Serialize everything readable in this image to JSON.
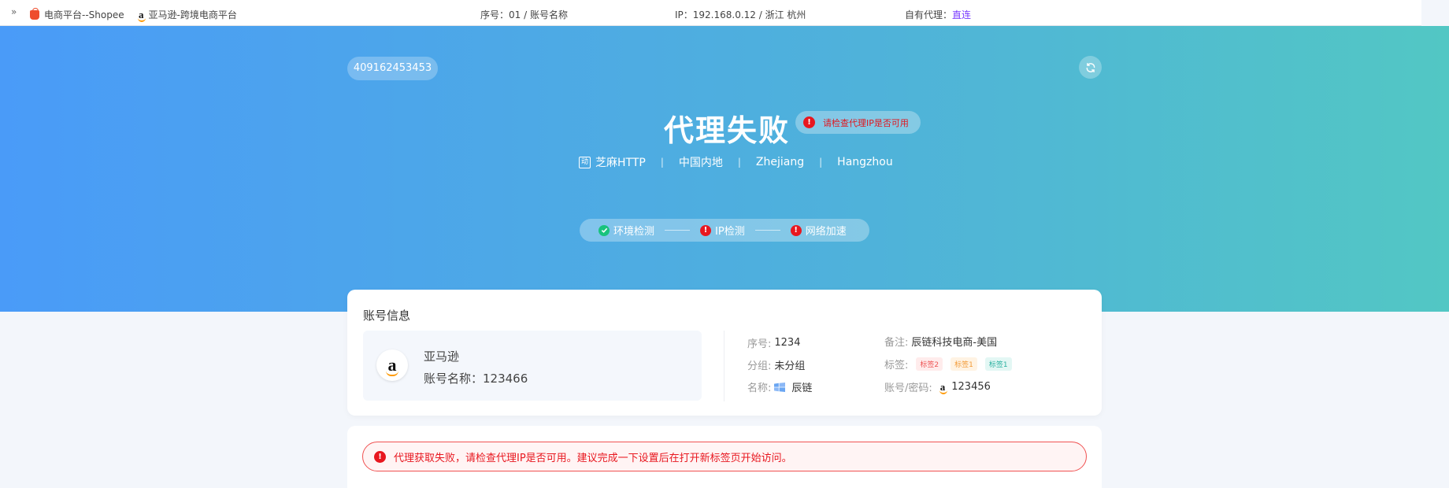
{
  "topbar": {
    "chevron": "»",
    "tab1_label": "电商平台--Shopee",
    "tab2_label": "亚马逊-跨境电商平台",
    "seq_text": "序号：01 / 账号名称",
    "ip_text": "IP：192.168.0.12 / 浙江 杭州",
    "proxy_label": "自有代理：",
    "proxy_value": "直连"
  },
  "hero": {
    "id_badge": "409162453453",
    "title": "代理失败",
    "warning": "请检查代理IP是否可用",
    "meta": [
      "芝麻HTTP",
      "中国内地",
      "Zhejiang",
      "Hangzhou"
    ],
    "http_icon_text": "动",
    "steps": [
      {
        "label": "环境检测",
        "status": "ok"
      },
      {
        "label": "IP检测",
        "status": "error"
      },
      {
        "label": "网络加速",
        "status": "error"
      }
    ]
  },
  "account": {
    "title": "账号信息",
    "platform": "亚马逊",
    "account_name": "账号名称：123466",
    "fields": {
      "seq_label": "序号:",
      "seq_value": "1234",
      "group_label": "分组:",
      "group_value": "未分组",
      "name_label": "名称:",
      "name_value": "辰链",
      "remark_label": "备注:",
      "remark_value": "辰链科技电商-美国",
      "tags_label": "标签:",
      "tags": [
        "标签2",
        "标签1",
        "标签1"
      ],
      "cred_label": "账号/密码:",
      "cred_value": "123456"
    }
  },
  "error": {
    "message": "代理获取失败，请检查代理IP是否可用。建议完成一下设置后在打开新标签页开始访问。"
  },
  "colors": {
    "hero_start": "#4a9bf8",
    "hero_end": "#52c7c4",
    "error_red": "#e8171f",
    "ok_green": "#19c37d",
    "proxy_link": "#7a3cff"
  }
}
